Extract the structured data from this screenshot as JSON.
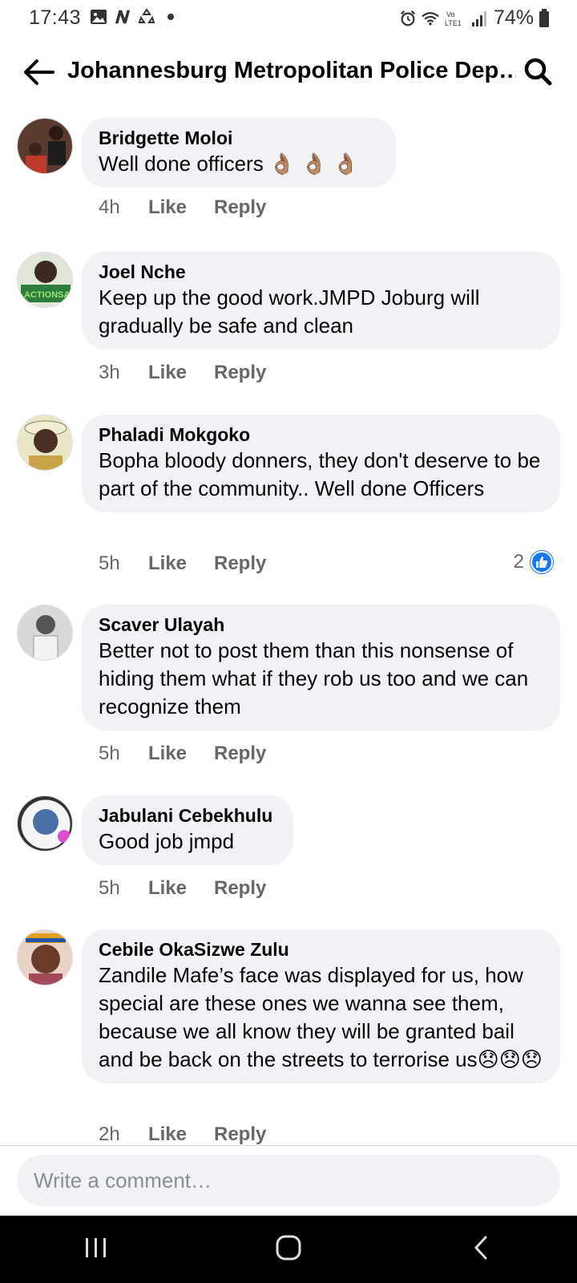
{
  "status_bar": {
    "time": "17:43",
    "battery": "74%",
    "left_icons": [
      "gallery-icon",
      "n-icon",
      "recycle-icon",
      "dot-icon"
    ],
    "right_icons": [
      "alarm-icon",
      "wifi-icon",
      "volte-icon",
      "signal-icon",
      "battery-icon"
    ]
  },
  "header": {
    "title": "Johannesburg Metropolitan Police Dep…",
    "back_icon": "back-arrow-icon",
    "search_icon": "search-icon"
  },
  "actions": {
    "like": "Like",
    "reply": "Reply"
  },
  "comments": [
    {
      "author": "Bridgette Moloi",
      "text": "Well done officers 👌🏽 👌🏽 👌🏽",
      "time": "4h",
      "avatar_color": "#7a4b3a"
    },
    {
      "author": "Joel Nche",
      "text": "Keep up the good work.JMPD Joburg will gradually be safe and clean",
      "time": "3h",
      "avatar_color": "#2f7d3a"
    },
    {
      "author": "Phaladi Mokgoko",
      "text": "Bopha bloody donners, they don't deserve to be part of the community.. Well done Officers",
      "time": "5h",
      "reactions": "2",
      "avatar_color": "#6b5a3a"
    },
    {
      "author": "Scaver Ulayah",
      "text": "Better not to post them than this nonsense of hiding them what if they rob us too and we can recognize them",
      "time": "5h",
      "avatar_color": "#9a9a9a"
    },
    {
      "author": "Jabulani Cebekhulu",
      "text": "Good job jmpd",
      "time": "5h",
      "avatar_color": "#4a6fa5"
    },
    {
      "author": "Cebile OkaSizwe Zulu",
      "text": "Zandile Mafe’s face was displayed for us, how special are these ones we wanna see them, because we all know they will be granted bail and be back on the streets to terrorise us😞😞😞",
      "time": "2h",
      "avatar_color": "#a04a5a"
    }
  ],
  "composer": {
    "placeholder": "Write a comment…"
  },
  "colors": {
    "accent": "#1877f2",
    "bubble": "#f0f2f5",
    "meta_text": "#65676b"
  }
}
